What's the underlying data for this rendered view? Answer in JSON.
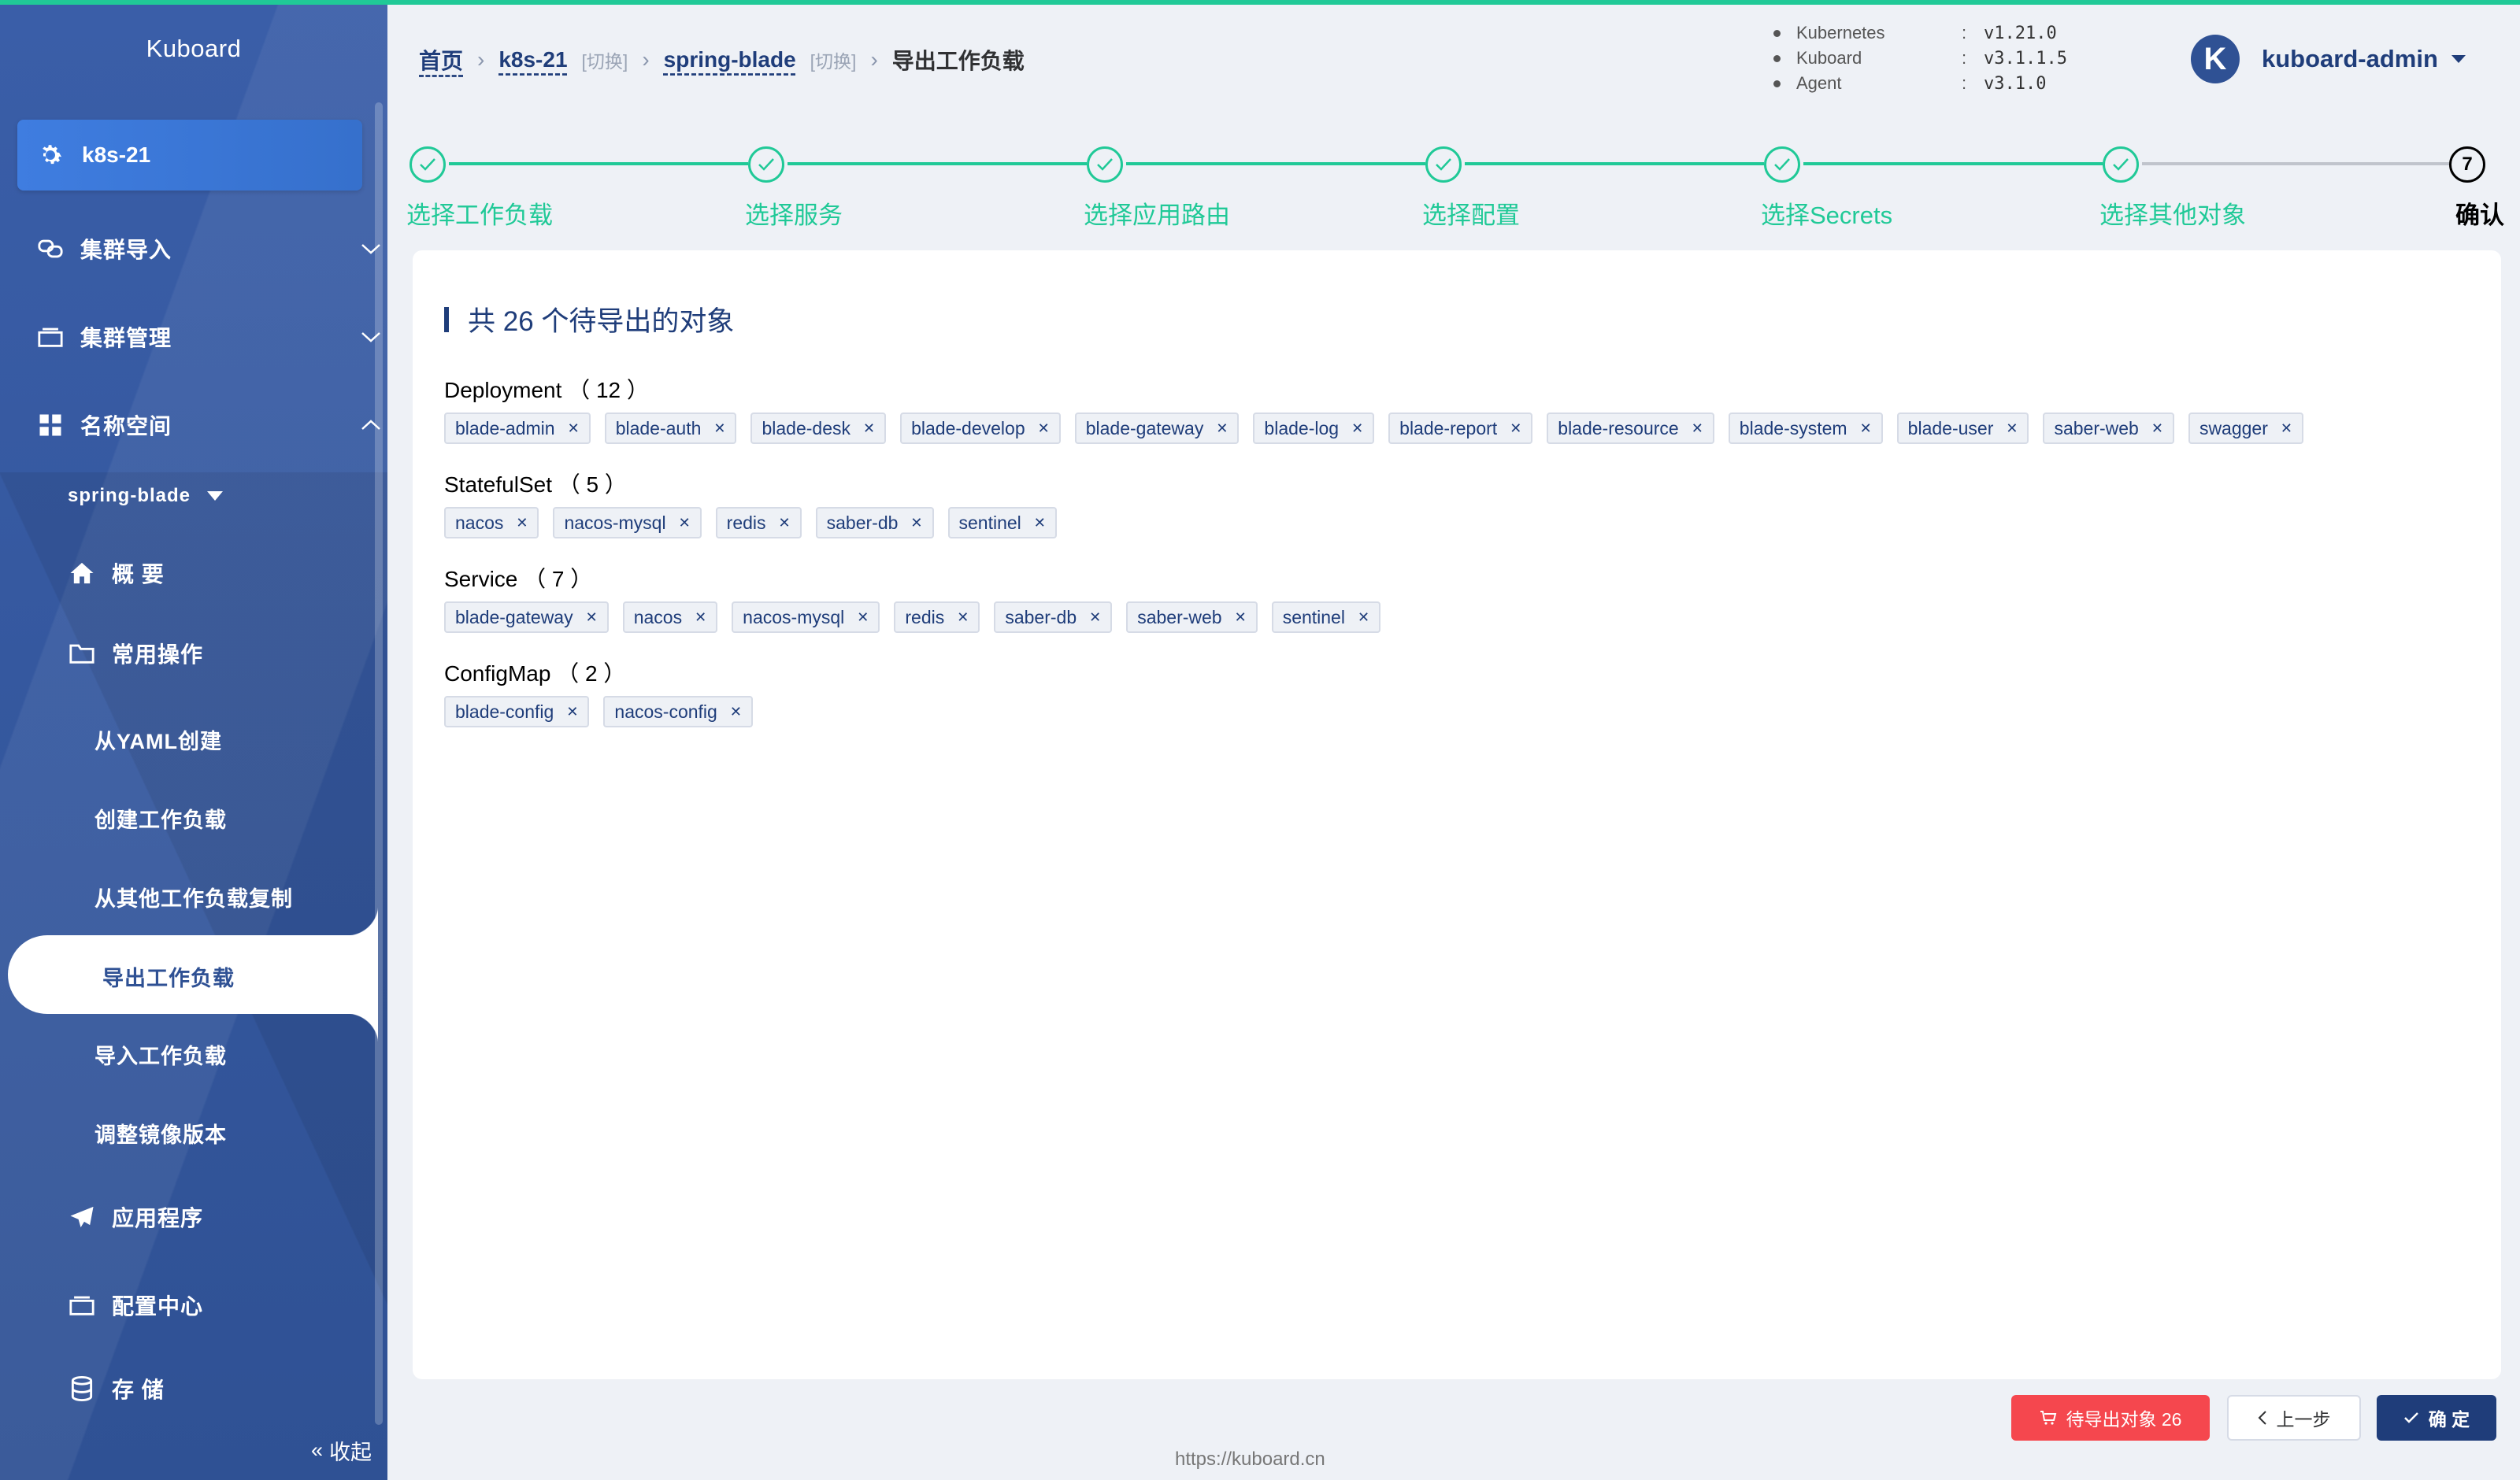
{
  "sidebar": {
    "brand": "Kuboard",
    "cluster": "k8s-21",
    "menu": {
      "import_cluster": "集群导入",
      "cluster_manage": "集群管理",
      "namespace": "名称空间",
      "ns_selected": "spring-blade",
      "overview": "概 要",
      "common_ops": "常用操作",
      "create_from_yaml": "从YAML创建",
      "create_workload": "创建工作负载",
      "copy_workload": "从其他工作负载复制",
      "export_workload": "导出工作负载",
      "import_workload": "导入工作负载",
      "adjust_image": "调整镜像版本",
      "apps": "应用程序",
      "config_center": "配置中心",
      "storage": "存 储"
    },
    "collapse": "收起"
  },
  "header": {
    "breadcrumb": {
      "home": "首页",
      "cluster": "k8s-21",
      "switch1": "[切换]",
      "namespace": "spring-blade",
      "switch2": "[切换]",
      "current": "导出工作负载"
    },
    "versions": [
      {
        "name": "Kubernetes",
        "value": "v1.21.0"
      },
      {
        "name": "Kuboard",
        "value": "v3.1.1.5"
      },
      {
        "name": "Agent",
        "value": "v3.1.0"
      }
    ],
    "avatar_letter": "K",
    "username": "kuboard-admin"
  },
  "steps": [
    {
      "label": "选择工作负载",
      "done": true
    },
    {
      "label": "选择服务",
      "done": true
    },
    {
      "label": "选择应用路由",
      "done": true
    },
    {
      "label": "选择配置",
      "done": true
    },
    {
      "label": "选择Secrets",
      "done": true
    },
    {
      "label": "选择其他对象",
      "done": true
    },
    {
      "label": "确认",
      "number": "7",
      "done": false
    }
  ],
  "summary": {
    "title": "共 26 个待导出的对象",
    "groups": [
      {
        "title": "Deployment （ 12 ）",
        "items": [
          "blade-admin",
          "blade-auth",
          "blade-desk",
          "blade-develop",
          "blade-gateway",
          "blade-log",
          "blade-report",
          "blade-resource",
          "blade-system",
          "blade-user",
          "saber-web",
          "swagger"
        ]
      },
      {
        "title": "StatefulSet （ 5 ）",
        "items": [
          "nacos",
          "nacos-mysql",
          "redis",
          "saber-db",
          "sentinel"
        ]
      },
      {
        "title": "Service （ 7 ）",
        "items": [
          "blade-gateway",
          "nacos",
          "nacos-mysql",
          "redis",
          "saber-db",
          "saber-web",
          "sentinel"
        ]
      },
      {
        "title": "ConfigMap （ 2 ）",
        "items": [
          "blade-config",
          "nacos-config"
        ]
      }
    ]
  },
  "footer": {
    "pending_button": "待导出对象 26",
    "prev_button": "上一步",
    "ok_button": "确 定",
    "url": "https://kuboard.cn"
  },
  "colors": {
    "sidebar": "#2f5194",
    "accent": "#20c997",
    "danger": "#f5474e",
    "primary": "#1f3d7a"
  }
}
